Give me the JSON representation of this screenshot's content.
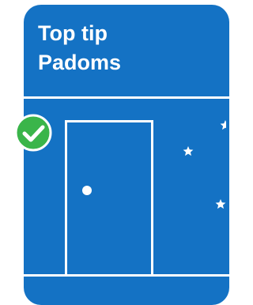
{
  "tip_card": {
    "title_line1": "Top tip",
    "title_line2": "Padoms"
  },
  "colors": {
    "card_background": "#1472c4",
    "check_badge": "#3ab54a",
    "foreground": "#ffffff"
  },
  "icons": {
    "badge": "checkmark-icon",
    "door": "door-icon",
    "moon": "crescent-moon-icon",
    "stars": "star-icon"
  }
}
